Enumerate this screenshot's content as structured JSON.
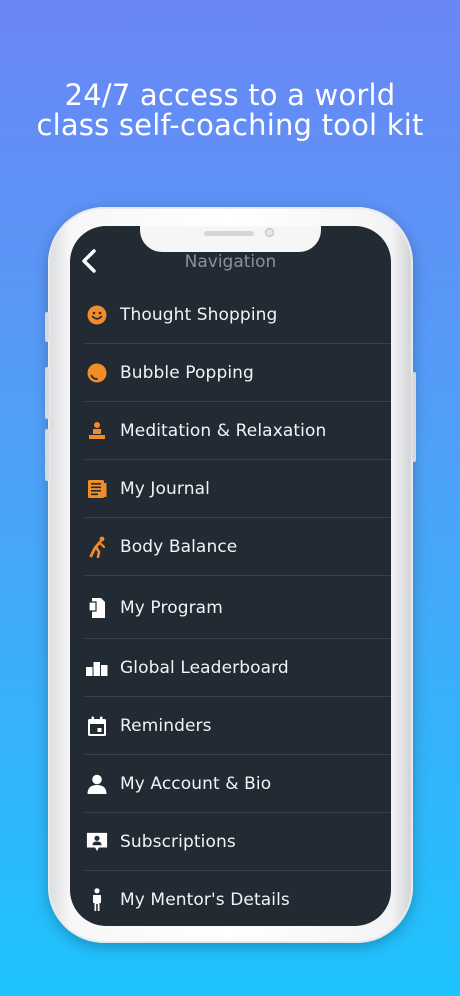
{
  "headline": {
    "line1": "24/7 access to a world",
    "line2": "class self-coaching tool kit"
  },
  "header": {
    "back_icon": "chevron-left-icon",
    "title": "Navigation"
  },
  "colors": {
    "accent_orange": "#f28c28",
    "icon_white": "#ffffff",
    "screen_bg": "#222b33"
  },
  "menu": {
    "items": [
      {
        "label": "Thought Shopping",
        "icon": "smiley-icon"
      },
      {
        "label": "Bubble Popping",
        "icon": "bubble-icon"
      },
      {
        "label": "Meditation & Relaxation",
        "icon": "meditation-icon"
      },
      {
        "label": "My Journal",
        "icon": "journal-icon"
      },
      {
        "label": "Body Balance",
        "icon": "body-balance-icon"
      },
      {
        "label": "My Program",
        "icon": "program-document-icon"
      },
      {
        "label": "Global Leaderboard",
        "icon": "leaderboard-icon"
      },
      {
        "label": "Reminders",
        "icon": "calendar-icon"
      },
      {
        "label": "My Account & Bio",
        "icon": "user-icon"
      },
      {
        "label": "Subscriptions",
        "icon": "subscription-badge-icon"
      },
      {
        "label": "My Mentor's Details",
        "icon": "mentor-icon"
      }
    ]
  }
}
